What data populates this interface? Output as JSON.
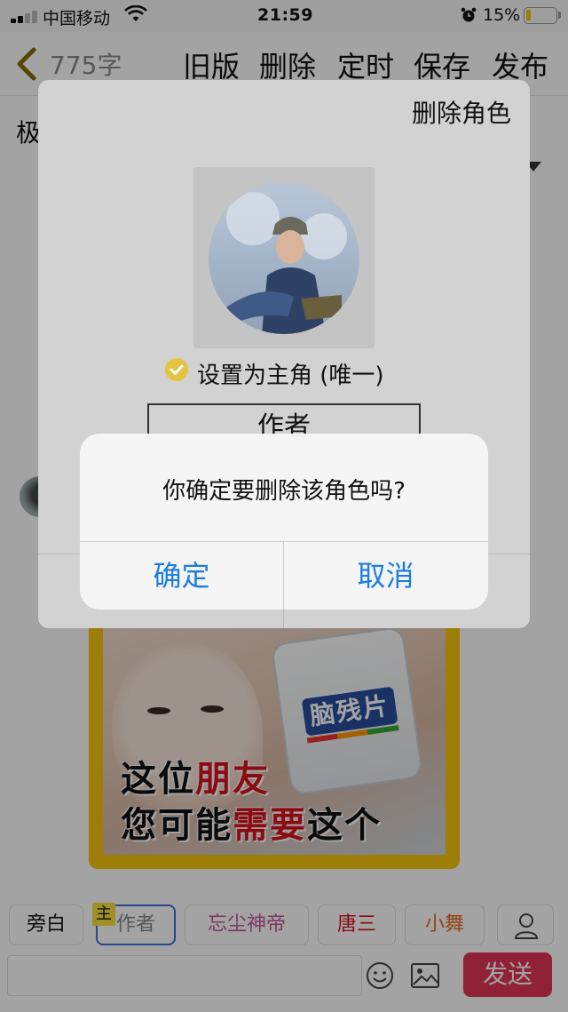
{
  "status_bar": {
    "carrier": "中国移动",
    "time": "21:59",
    "battery_percent": "15%",
    "battery_level": 0.15
  },
  "header": {
    "word_count": "775字",
    "buttons": [
      "旧版",
      "删除",
      "定时",
      "保存",
      "发布"
    ]
  },
  "background": {
    "title_char": "极",
    "meme_line1_a": "这位",
    "meme_line1_b": "朋友",
    "meme_line2_a": "您可能",
    "meme_line2_b": "需要",
    "meme_line2_c": "这个",
    "bottle_label": "脑残片"
  },
  "role_dialog": {
    "delete_role": "删除角色",
    "set_main_role": "设置为主角 (唯一)",
    "role_name": "作者"
  },
  "alert": {
    "message": "你确定要删除该角色吗?",
    "confirm": "确定",
    "cancel": "取消"
  },
  "role_bar": {
    "main_tag": "主",
    "chips": [
      "旁白",
      "作者",
      "忘尘神帝",
      "唐三",
      "小舞"
    ],
    "chip_colors": [
      "#111111",
      "#888888",
      "#c2569a",
      "#d8121b",
      "#e86a1b"
    ]
  },
  "composer": {
    "send": "发送"
  },
  "colors": {
    "ios_blue": "#1a7de0",
    "send_red": "#e23555",
    "check_yellow": "#e5c23f"
  }
}
